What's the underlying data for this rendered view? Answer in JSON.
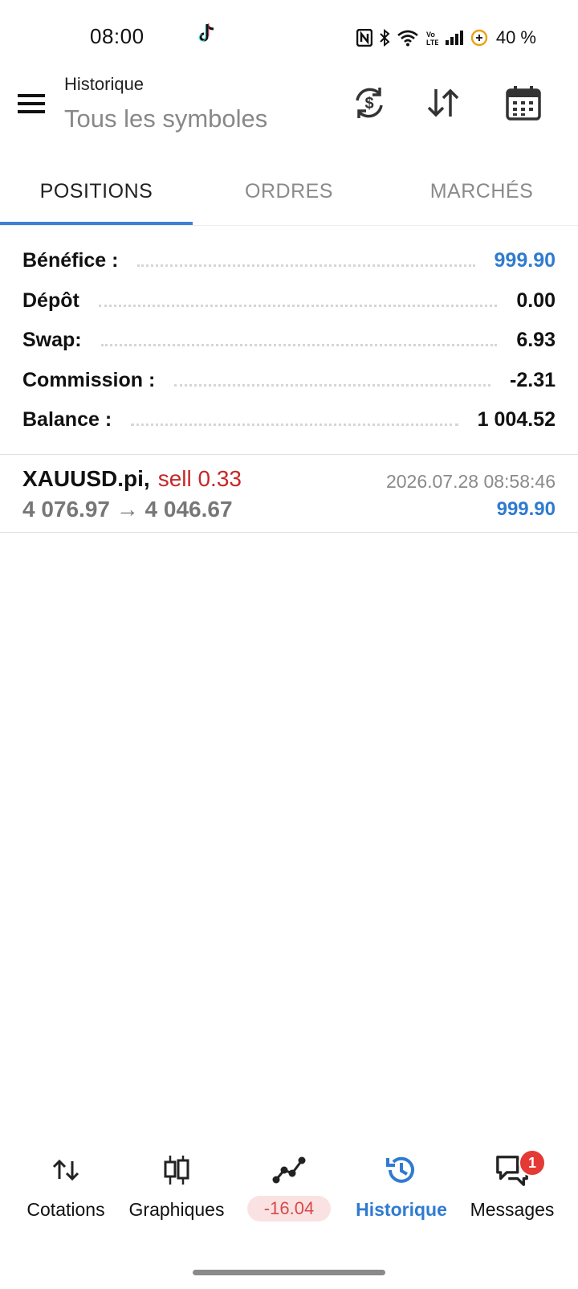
{
  "status_bar": {
    "time": "08:00",
    "battery": "40 %"
  },
  "app_bar": {
    "title": "Historique",
    "subtitle": "Tous les symboles"
  },
  "tabs": [
    {
      "label": "POSITIONS",
      "active": true
    },
    {
      "label": "ORDRES",
      "active": false
    },
    {
      "label": "MARCHÉS",
      "active": false
    }
  ],
  "summary": {
    "rows": [
      {
        "label": "Bénéfice :",
        "value": "999.90"
      },
      {
        "label": "Dépôt",
        "value": "0.00"
      },
      {
        "label": "Swap:",
        "value": "6.93"
      },
      {
        "label": "Commission :",
        "value": "-2.31"
      },
      {
        "label": "Balance :",
        "value": "1 004.52"
      }
    ]
  },
  "deals": [
    {
      "symbol": "XAUUSD.pi,",
      "type": "sell 0.33",
      "prices": "4 076.97 → 4 046.67",
      "time": "2026.07.28 08:58:46",
      "profit": "999.90"
    }
  ],
  "bottom_nav": {
    "items": [
      {
        "label": "Cotations",
        "icon": "arrows-updown-icon"
      },
      {
        "label": "Graphiques",
        "icon": "candlestick-icon"
      },
      {
        "label": "-16.04",
        "icon": "trade-chart-icon"
      },
      {
        "label": "Historique",
        "icon": "history-icon",
        "active": true
      },
      {
        "label": "Messages",
        "icon": "messages-icon",
        "badge": "1"
      }
    ]
  },
  "colors": {
    "accent": "#2f7bd1",
    "sell": "#c62828",
    "negative_pill_bg": "#fbe2e2",
    "badge": "#e53935"
  }
}
